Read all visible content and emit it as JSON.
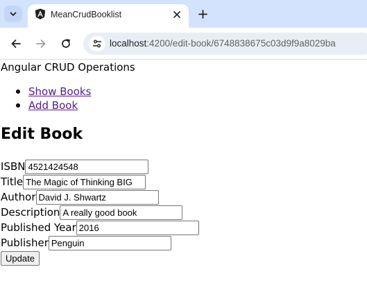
{
  "browser": {
    "tab_title": "MeanCrudBooklist",
    "url_host": "localhost",
    "url_path": ":4200/edit-book/6748838675c03d9f9a8029ba",
    "icons": {
      "tab_list": "chevron-down-icon",
      "favicon": "angular-icon",
      "close": "close-icon",
      "new_tab": "plus-icon",
      "back": "back-arrow-icon",
      "forward": "forward-arrow-icon",
      "reload": "reload-icon",
      "site_info": "site-info-icon"
    }
  },
  "page": {
    "app_title": "Angular CRUD Operations",
    "nav": [
      {
        "label": "Show Books"
      },
      {
        "label": "Add Book"
      }
    ],
    "heading": "Edit Book",
    "fields": [
      {
        "label": "ISBN",
        "value": "4521424548"
      },
      {
        "label": "Title",
        "value": "The Magic of Thinking BIG"
      },
      {
        "label": "Author",
        "value": "David J. Shwartz"
      },
      {
        "label": "Description",
        "value": "A really good book"
      },
      {
        "label": "Published Year",
        "value": "2016"
      },
      {
        "label": "Publisher",
        "value": "Penguin"
      }
    ],
    "submit_label": "Update"
  },
  "colors": {
    "tabbar_bg": "#d3e3fd",
    "link_visited": "#551a8b",
    "angular_red": "#dd0031"
  }
}
